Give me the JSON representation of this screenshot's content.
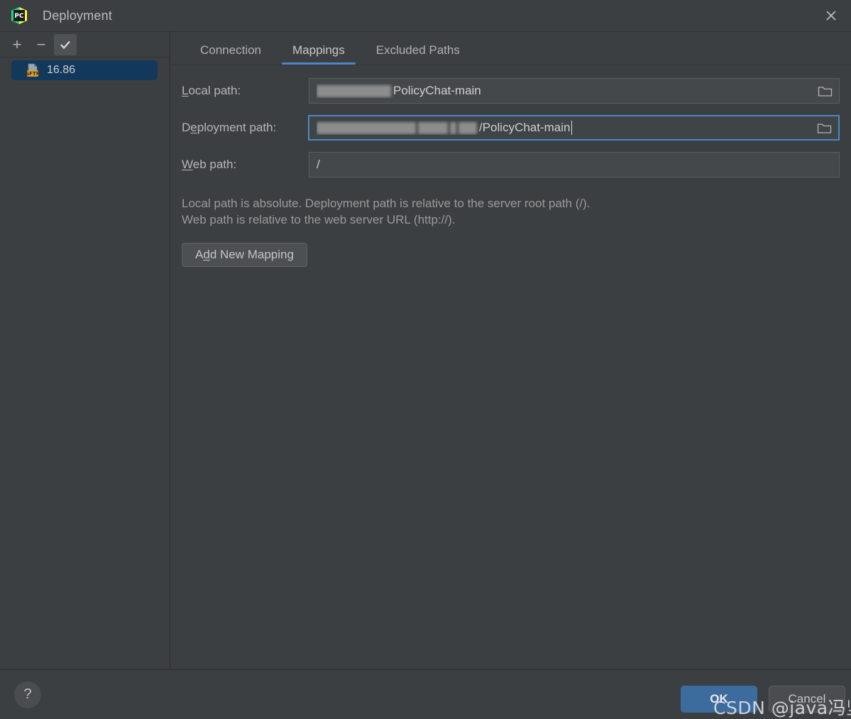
{
  "window": {
    "title": "Deployment",
    "app_icon": "pycharm-logo-icon",
    "close_icon": "close-icon"
  },
  "sidebar": {
    "toolbar": {
      "add_label": "+",
      "remove_label": "−",
      "check_label": "✔",
      "add_icon": "plus-icon",
      "remove_icon": "minus-icon",
      "default_icon": "check-icon"
    },
    "items": [
      {
        "label": "16.86",
        "icon": "sftp-server-icon",
        "badge": "SFTP",
        "selected": true
      }
    ]
  },
  "tabs": [
    {
      "label": "Connection",
      "active": false
    },
    {
      "label": "Mappings",
      "active": true
    },
    {
      "label": "Excluded Paths",
      "active": false
    }
  ],
  "form": {
    "local_path": {
      "label_prefix": "L",
      "label_rest": "ocal path:",
      "value_redacted": true,
      "value": "PolicyChat-main",
      "browse_icon": "folder-icon"
    },
    "deployment_path": {
      "label_prefix": "D",
      "label_mnemonic": "e",
      "label_rest": "ployment path:",
      "value_redacted": true,
      "value": "/PolicyChat-main",
      "browse_icon": "folder-icon",
      "focused": true
    },
    "web_path": {
      "label_prefix": "W",
      "label_rest": "eb path:",
      "value": "/"
    }
  },
  "hints": [
    "Local path is absolute. Deployment path is relative to the server root path (/).",
    "Web path is relative to the web server URL (http://)."
  ],
  "add_mapping_button": {
    "prefix": "A",
    "mnemonic": "d",
    "rest": "d New Mapping"
  },
  "footer": {
    "help_label": "?",
    "help_icon": "help-icon",
    "ok_label": "OK",
    "cancel_label": "Cancel"
  },
  "watermark": "CSDN @java冯坚持",
  "colors": {
    "background": "#3c3f41",
    "field_background": "#45484a",
    "accent_blue": "#4a88c7",
    "selection_blue": "#12385c",
    "ok_button": "#3c6b9e",
    "sftp_badge": "#d9a036"
  }
}
